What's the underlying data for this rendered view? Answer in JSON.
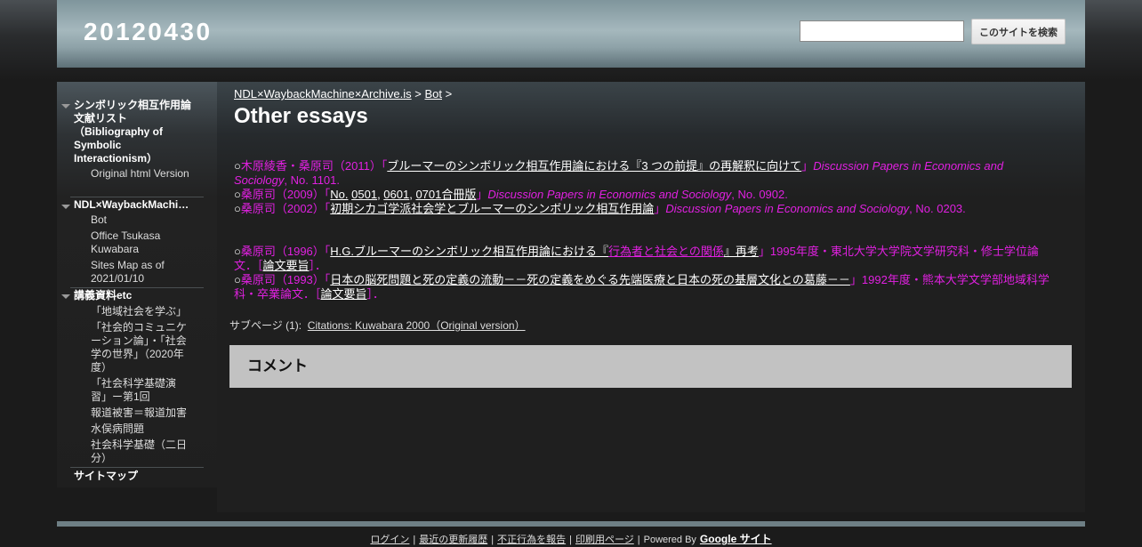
{
  "header": {
    "site_title": "20120430",
    "search_placeholder": "",
    "search_button": "このサイトを検索"
  },
  "sidebar": {
    "sections": [
      {
        "heading": "シンボリック相互作用論文献リスト（Bibliography of Symbolic Interactionism）",
        "items": [
          "Original html Version"
        ]
      },
      {
        "heading": "NDL×WaybackMachine×Archive.is",
        "items": [
          "Bot",
          "Office Tsukasa Kuwabara",
          "Sites Map as of 2021/01/10"
        ]
      },
      {
        "heading": "講義資料etc",
        "items": [
          "「地域社会を学ぶ」",
          "「社会的コミュニケーション論」・「社会学の世界」（2020年度）",
          "「社会科学基礎演習」ー第1回",
          "報道被害＝報道加害",
          "水俣病問題",
          "社会科学基礎（二日分）"
        ]
      }
    ],
    "sitemap": "サイトマップ"
  },
  "main": {
    "breadcrumb": {
      "crumb1": "NDL×WaybackMachine×Archive.is",
      "sep1": " > ",
      "crumb2": "Bot",
      "sep2": " >"
    },
    "title": "Other essays",
    "entries": [
      {
        "bullet": "○",
        "authors": "木原綾香・桑原司（2011）「",
        "title_link": "ブルーマーのシンボリック相互作用論における『3 つの前提』の再解釈に向けて",
        "close": "」",
        "journal": "Discussion Papers in Economics and Sociology",
        "tail": ", No. 1101."
      },
      {
        "bullet": "○",
        "authors": "桑原司（2009）「",
        "links": [
          "No.",
          "0501",
          "0601",
          "0701合冊版"
        ],
        "close": "」",
        "journal": "Discussion Papers in Economics and Sociology",
        "tail": ", No. 0902."
      },
      {
        "bullet": "○",
        "authors": "桑原司（2002）「",
        "title_link": "初期シカゴ学派社会学とブルーマーのシンボリック相互作用論",
        "close": "」",
        "journal": "Discussion Papers in Economics and Sociology",
        "tail": ", No. 0203."
      },
      {
        "bullet": "○",
        "authors": "桑原司（1996）「",
        "title_link_a": "H.G.ブルーマーのシンボリック相互作用論における『",
        "pink_link": "行為者と社会との関係",
        "title_link_b": "』再考",
        "tail": "」1995年度・東北大学大学院文学研究科・修士学位論文．［",
        "summary_link": "論文要旨",
        "end": "］．"
      },
      {
        "bullet": "○",
        "authors": "桑原司（1993）「",
        "title_link": "日本の脳死問題と死の定義の流動－－死の定義をめぐる先端医療と日本の死の基層文化との葛藤－－",
        "tail": "」1992年度・熊本大学文学部地域科学科・卒業論文．［",
        "summary_link": "論文要旨",
        "end": "］．"
      }
    ],
    "subpages_label": "サブページ (1):",
    "subpages_link": "Citations: Kuwabara 2000（Original version）",
    "comment_heading": "コメント"
  },
  "footer": {
    "links": [
      "ログイン",
      "最近の更新履歴",
      "不正行為を報告",
      "印刷用ページ"
    ],
    "powered_by": "Powered By",
    "google_sites": "Google サイト"
  },
  "colors": {
    "accent_pink": "#e020e0",
    "header_bg": "#a5b8bd",
    "comment_bg": "#c2c2c2"
  }
}
